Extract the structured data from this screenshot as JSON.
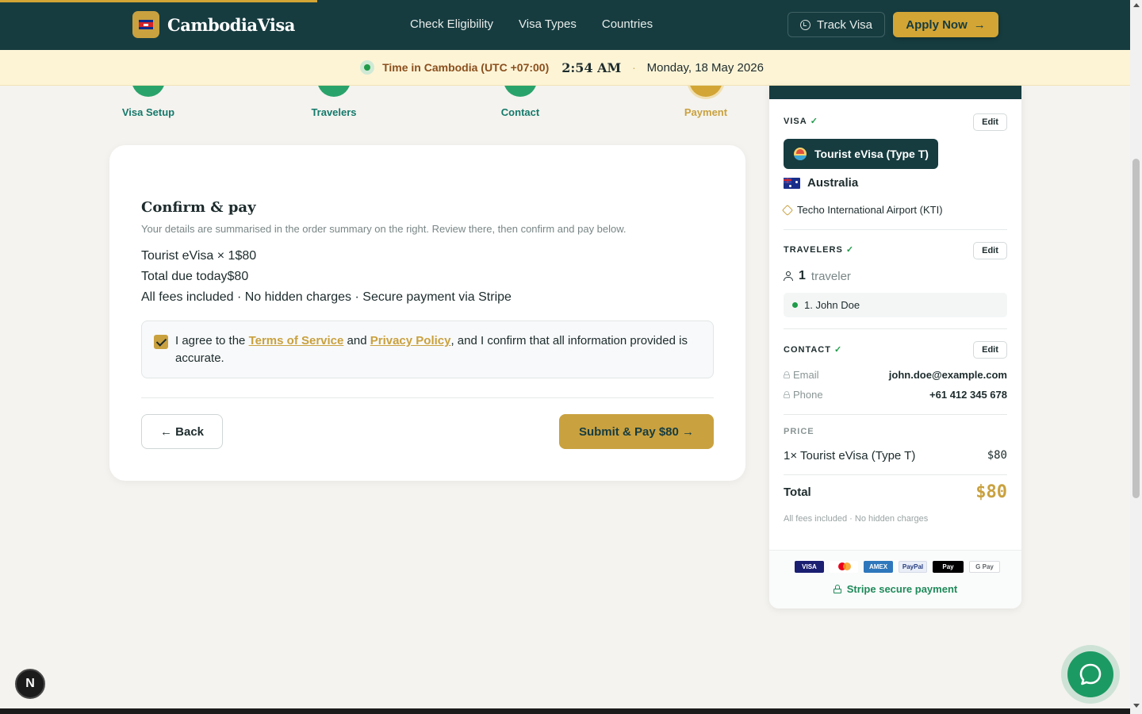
{
  "header": {
    "brand": "CambodiaVisa",
    "nav": [
      "Check Eligibility",
      "Visa Types",
      "Countries"
    ],
    "track_label": "Track Visa",
    "apply_label": "Apply Now",
    "apply_arrow": "→"
  },
  "timebar": {
    "label": "Time in Cambodia (UTC +07:00)",
    "time": "2:54 AM",
    "separator": "·",
    "date": "Monday, 18 May 2026"
  },
  "steps": [
    {
      "label": "Visa Setup",
      "state": "done"
    },
    {
      "label": "Travelers",
      "state": "done"
    },
    {
      "label": "Contact",
      "state": "done"
    },
    {
      "label": "Payment",
      "state": "current"
    }
  ],
  "confirm": {
    "title": "Confirm & pay",
    "subtitle": "Your details are summarised in the order summary on the right. Review there, then confirm and pay below.",
    "line_item": "Tourist eVisa × 1$80",
    "total_line": "Total due today$80",
    "fees_line": "All fees included · No hidden charges · Secure payment via Stripe",
    "agree_prefix": "I agree to the ",
    "terms_link": "Terms of Service",
    "agree_and": " and ",
    "privacy_link": "Privacy Policy",
    "agree_suffix": ", and I confirm that all information provided is accurate.",
    "agree_checked": true,
    "back_label": "← Back",
    "pay_label": "Submit & Pay $80 →"
  },
  "summary": {
    "visa_title": "VISA",
    "check": "✓",
    "edit_label": "Edit",
    "visa_type": "Tourist eVisa (Type T)",
    "country": "Australia",
    "port": "Techo International Airport (KTI)",
    "travelers_title": "TRAVELERS",
    "traveler_count": "1",
    "traveler_word": "traveler",
    "travelers": [
      "1. John Doe"
    ],
    "contact_title": "CONTACT",
    "email_label": "Email",
    "email": "john.doe@example.com",
    "phone_label": "Phone",
    "phone": "+61 412 345 678",
    "price_title": "PRICE",
    "price_item": "1× Tourist eVisa (Type T)",
    "price_value": "$80",
    "total_label": "Total",
    "total_value": "$80",
    "fees_note": "All fees included · No hidden charges",
    "payment_logos": [
      "VISA",
      "",
      "AMEX",
      "PayPal",
      " Pay",
      "G Pay"
    ],
    "stripe_label": "Stripe secure payment"
  },
  "misc": {
    "next_badge": "N"
  },
  "colors": {
    "brand_dark": "#163c40",
    "gold": "#d2a535",
    "green": "#2aa36b"
  }
}
